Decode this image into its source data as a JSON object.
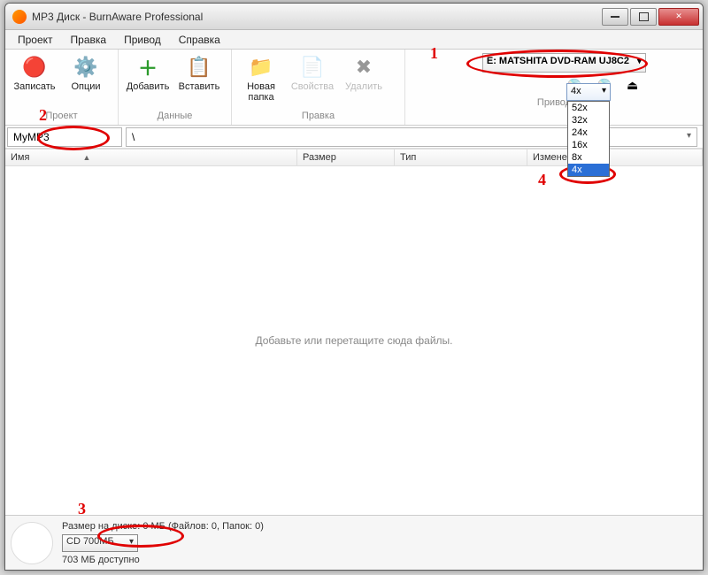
{
  "title": "MP3 Диск - BurnAware Professional",
  "menu": [
    "Проект",
    "Правка",
    "Привод",
    "Справка"
  ],
  "ribbon": {
    "groups": {
      "project": {
        "label": "Проект",
        "burn": "Записать",
        "options": "Опции"
      },
      "data": {
        "label": "Данные",
        "add": "Добавить",
        "paste": "Вставить"
      },
      "edit": {
        "label": "Правка",
        "newfolder": "Новая\nпапка",
        "props": "Свойства",
        "delete": "Удалить"
      },
      "drive": {
        "label": "Привод"
      }
    },
    "drive_selected": "E: MATSHITA DVD-RAM UJ8C2",
    "speed_selected": "4x",
    "speed_options": [
      "52x",
      "32x",
      "24x",
      "16x",
      "8x",
      "4x"
    ]
  },
  "project_name": "MyMP3",
  "path": "\\",
  "columns": {
    "name": "Имя",
    "size": "Размер",
    "type": "Тип",
    "modified": "Изменен"
  },
  "empty_hint": "Добавьте или перетащите сюда файлы.",
  "status": {
    "disk_size_line": "Размер на диске: 0 МБ (Файлов: 0, Папок: 0)",
    "disc_type": "CD 700МБ",
    "available": "703 МБ доступно"
  },
  "annotations": {
    "n1": "1",
    "n2": "2",
    "n3": "3",
    "n4": "4"
  }
}
